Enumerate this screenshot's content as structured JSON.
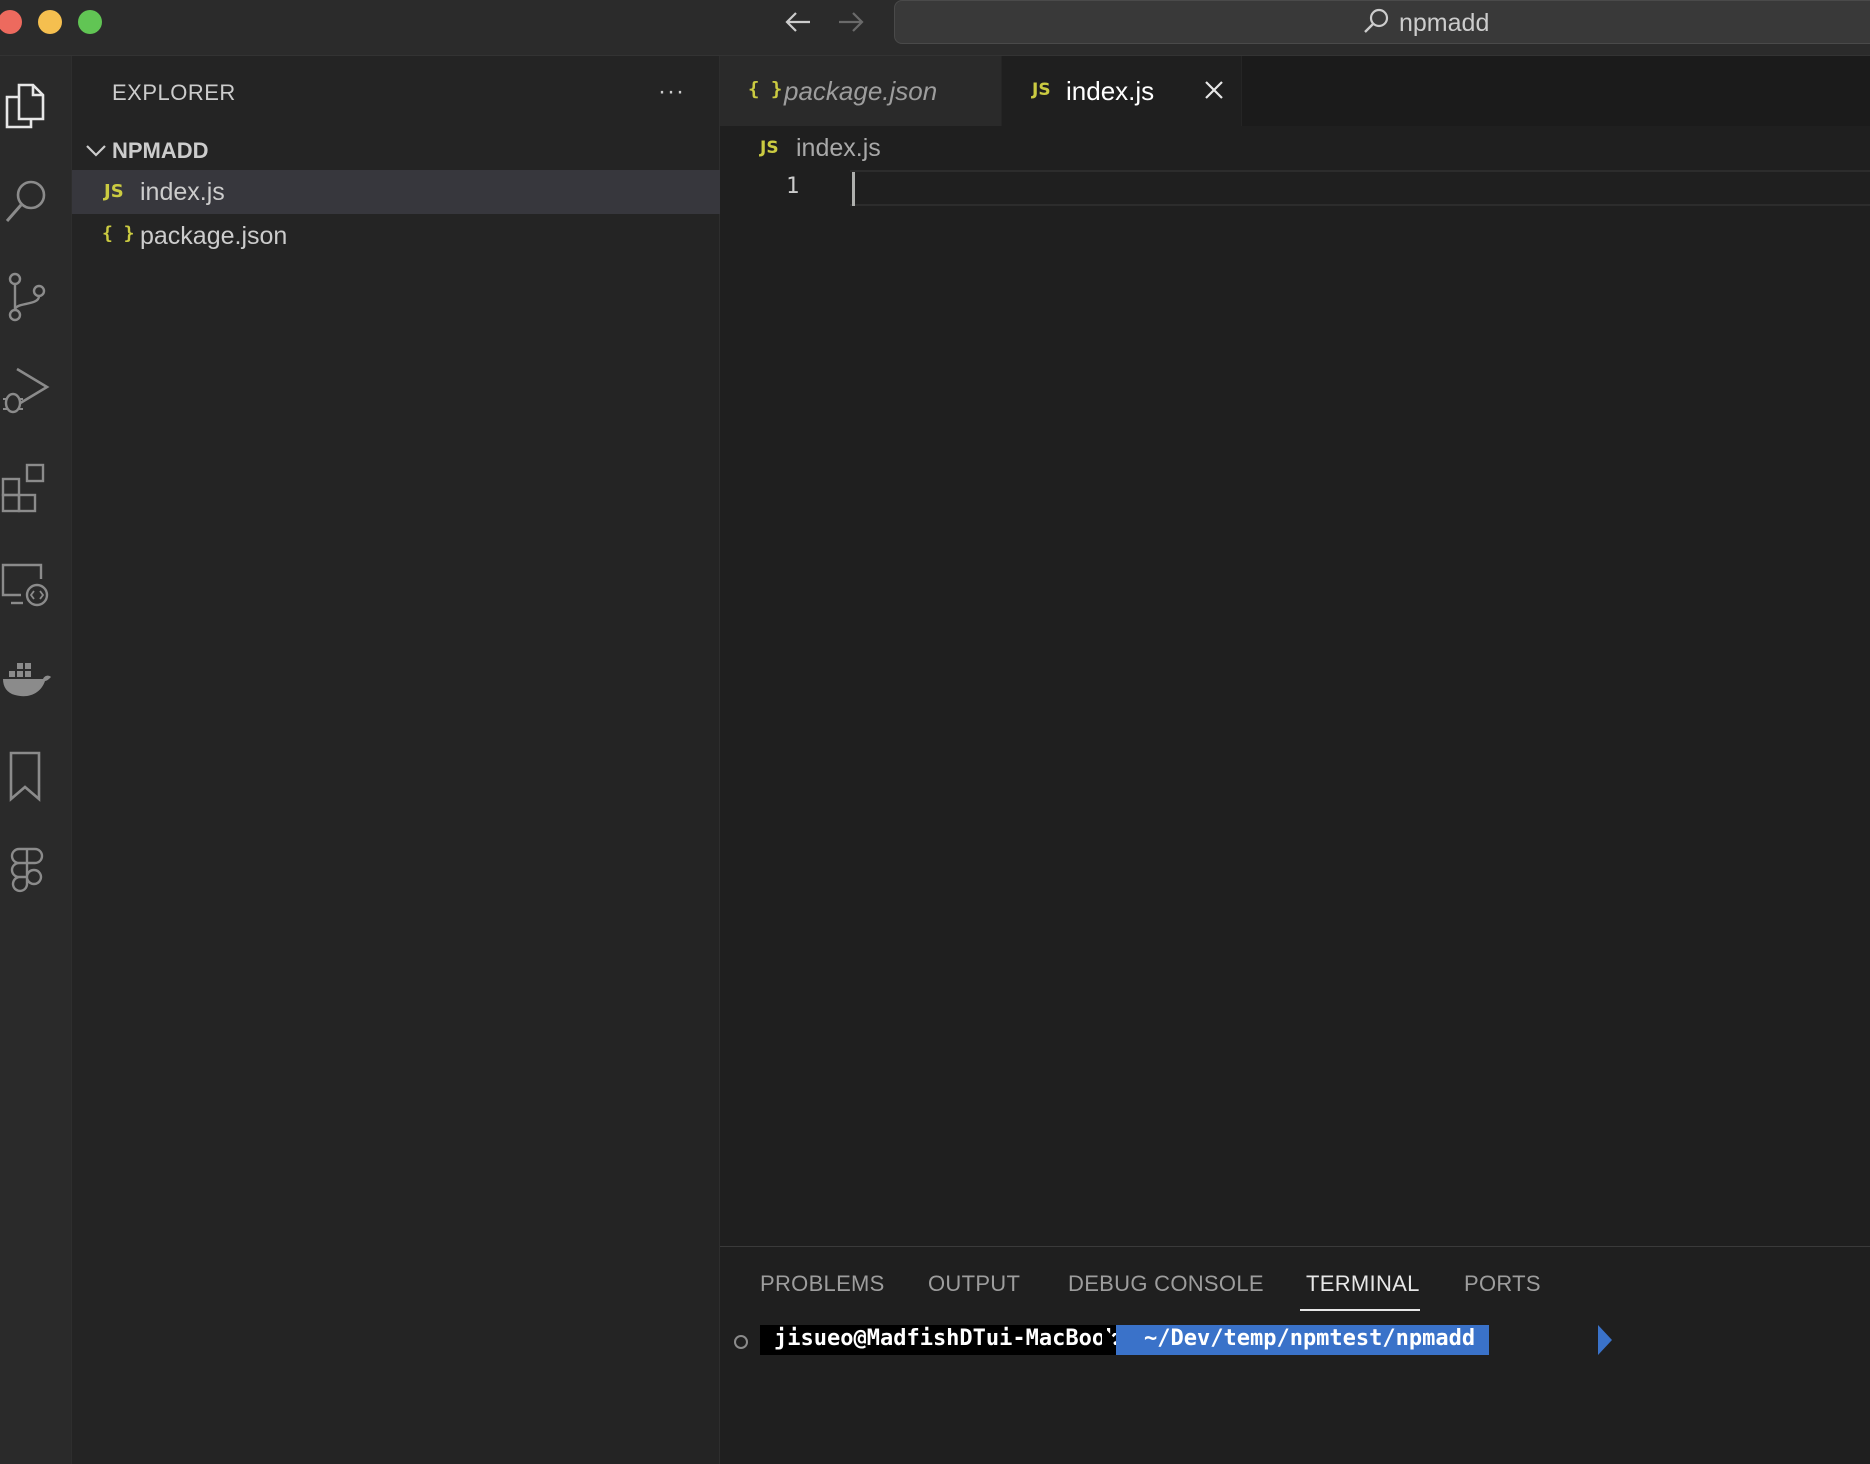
{
  "window": {
    "search_text": "npmadd"
  },
  "sidebar": {
    "title": "EXPLORER",
    "more_label": "···",
    "folder": "NPMADD",
    "files": [
      {
        "icon": "JS",
        "name": "index.js",
        "active": true
      },
      {
        "icon": "{ }",
        "name": "package.json",
        "active": false
      }
    ]
  },
  "tabs": [
    {
      "icon": "{ }",
      "label": "package.json",
      "preview": true,
      "active": false
    },
    {
      "icon": "JS",
      "label": "index.js",
      "preview": false,
      "active": true
    }
  ],
  "breadcrumb": {
    "icon": "JS",
    "label": "index.js"
  },
  "editor": {
    "line_numbers": [
      "1"
    ]
  },
  "panel": {
    "tabs": [
      "PROBLEMS",
      "OUTPUT",
      "DEBUG CONSOLE",
      "TERMINAL",
      "PORTS"
    ],
    "active_tab": "TERMINAL",
    "terminal": {
      "user_host": "jisueo@MadfishDTui-MacBookAir",
      "path": "~/Dev/temp/npmtest/npmadd"
    }
  },
  "colors": {
    "js_icon": "#cbcb41",
    "terminal_path_bg": "#3a72c9",
    "traffic_close": "#ed6a5e",
    "traffic_min": "#f5bf4f",
    "traffic_max": "#61c554"
  }
}
